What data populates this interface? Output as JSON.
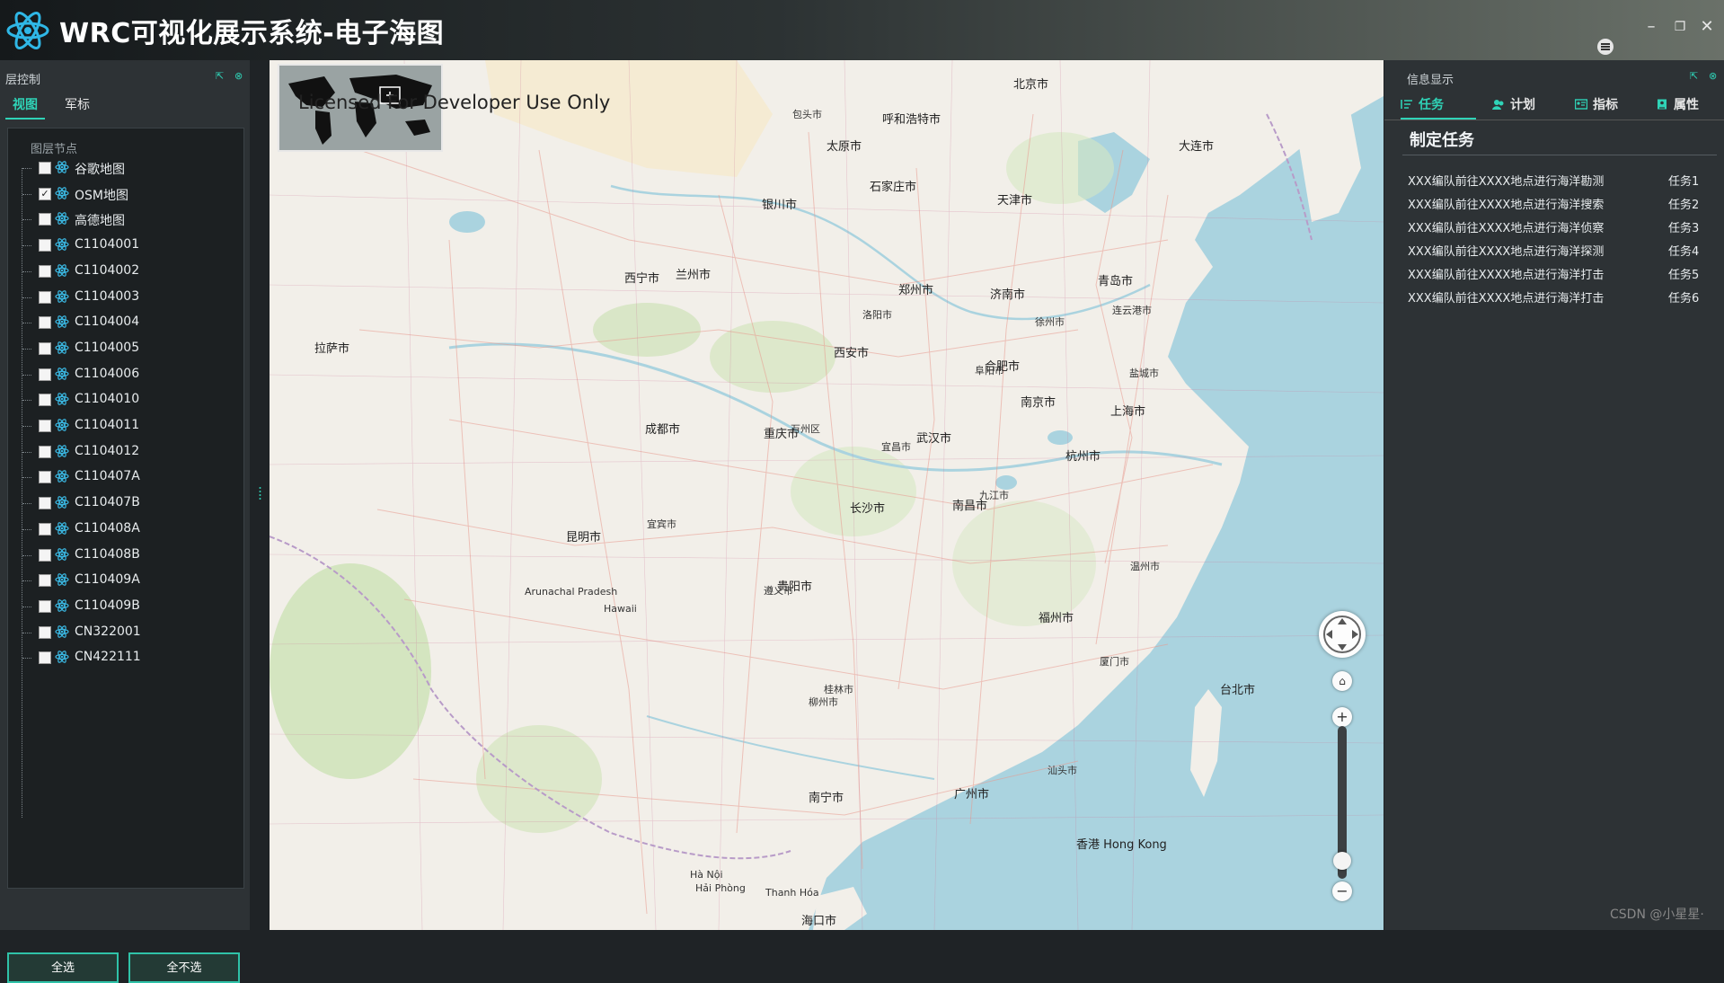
{
  "window": {
    "title": "WRC可视化展示系统-电子海图",
    "controls": [
      "minimize-icon",
      "restore-icon",
      "close-icon"
    ]
  },
  "left_panel": {
    "title": "层控制",
    "tabs": [
      {
        "label": "视图",
        "active": true
      },
      {
        "label": "军标",
        "active": false
      }
    ],
    "tree_header": "图层节点",
    "layers": [
      {
        "label": "谷歌地图",
        "checked": false
      },
      {
        "label": "OSM地图",
        "checked": true
      },
      {
        "label": "高德地图",
        "checked": false
      },
      {
        "label": "C1104001",
        "checked": false
      },
      {
        "label": "C1104002",
        "checked": false
      },
      {
        "label": "C1104003",
        "checked": false
      },
      {
        "label": "C1104004",
        "checked": false
      },
      {
        "label": "C1104005",
        "checked": false
      },
      {
        "label": "C1104006",
        "checked": false
      },
      {
        "label": "C1104010",
        "checked": false
      },
      {
        "label": "C1104011",
        "checked": false
      },
      {
        "label": "C1104012",
        "checked": false
      },
      {
        "label": "C110407A",
        "checked": false
      },
      {
        "label": "C110407B",
        "checked": false
      },
      {
        "label": "C110408A",
        "checked": false
      },
      {
        "label": "C110408B",
        "checked": false
      },
      {
        "label": "C110409A",
        "checked": false
      },
      {
        "label": "C110409B",
        "checked": false
      },
      {
        "label": "CN322001",
        "checked": false
      },
      {
        "label": "CN422111",
        "checked": false
      }
    ],
    "select_all_label": "全选",
    "select_none_label": "全不选"
  },
  "map": {
    "license_text": "Licensed For Developer Use Only",
    "places": [
      {
        "name": "北京市"
      },
      {
        "name": "天津市"
      },
      {
        "name": "石家庄市"
      },
      {
        "name": "太原市"
      },
      {
        "name": "济南市"
      },
      {
        "name": "郑州市"
      },
      {
        "name": "西安市"
      },
      {
        "name": "兰州市"
      },
      {
        "name": "银川市"
      },
      {
        "name": "西宁市"
      },
      {
        "name": "成都市"
      },
      {
        "name": "重庆市"
      },
      {
        "name": "武汉市"
      },
      {
        "name": "长沙市"
      },
      {
        "name": "南京市"
      },
      {
        "name": "上海市"
      },
      {
        "name": "杭州市"
      },
      {
        "name": "合肥市"
      },
      {
        "name": "南昌市"
      },
      {
        "name": "福州市"
      },
      {
        "name": "广州市"
      },
      {
        "name": "南宁市"
      },
      {
        "name": "贵阳市"
      },
      {
        "name": "昆明市"
      },
      {
        "name": "香港 Hong Kong"
      },
      {
        "name": "台北市"
      },
      {
        "name": "青岛市"
      },
      {
        "name": "大连市"
      },
      {
        "name": "呼和浩特市"
      },
      {
        "name": "包头市"
      },
      {
        "name": "海口市"
      },
      {
        "name": "拉萨市"
      },
      {
        "name": "洛阳市"
      },
      {
        "name": "温州市"
      },
      {
        "name": "厦门市"
      },
      {
        "name": "汕头市"
      },
      {
        "name": "柳州市"
      },
      {
        "name": "桂林市"
      },
      {
        "name": "遵义市"
      },
      {
        "name": "宜宾市"
      },
      {
        "name": "万州区"
      },
      {
        "name": "宜昌市"
      },
      {
        "name": "九江市"
      },
      {
        "name": "阜阳市"
      },
      {
        "name": "徐州市"
      },
      {
        "name": "连云港市"
      },
      {
        "name": "盐城市"
      },
      {
        "name": "Hawaii"
      },
      {
        "name": "Arunachal Pradesh"
      },
      {
        "name": "Hà Nội"
      },
      {
        "name": "Hải Phòng"
      },
      {
        "name": "Thanh Hóa"
      }
    ]
  },
  "right_panel": {
    "title": "信息显示",
    "tabs": [
      {
        "label": "任务",
        "icon": "list-icon",
        "active": true
      },
      {
        "label": "计划",
        "icon": "people-icon",
        "active": false
      },
      {
        "label": "指标",
        "icon": "card-icon",
        "active": false
      },
      {
        "label": "属性",
        "icon": "doc-icon",
        "active": false
      }
    ],
    "section_title": "制定任务",
    "tasks": [
      {
        "desc": "XXX编队前往XXXX地点进行海洋勘测",
        "id": "任务1"
      },
      {
        "desc": "XXX编队前往XXXX地点进行海洋搜索",
        "id": "任务2"
      },
      {
        "desc": "XXX编队前往XXXX地点进行海洋侦察",
        "id": "任务3"
      },
      {
        "desc": "XXX编队前往XXXX地点进行海洋探测",
        "id": "任务4"
      },
      {
        "desc": "XXX编队前往XXXX地点进行海洋打击",
        "id": "任务5"
      },
      {
        "desc": "XXX编队前往XXXX地点进行海洋打击",
        "id": "任务6"
      }
    ]
  },
  "watermark": "CSDN @小星星·",
  "colors": {
    "accent": "#2fd3b7",
    "panel": "#2d3235",
    "sea": "#aad3df",
    "land": "#f2efe9"
  }
}
